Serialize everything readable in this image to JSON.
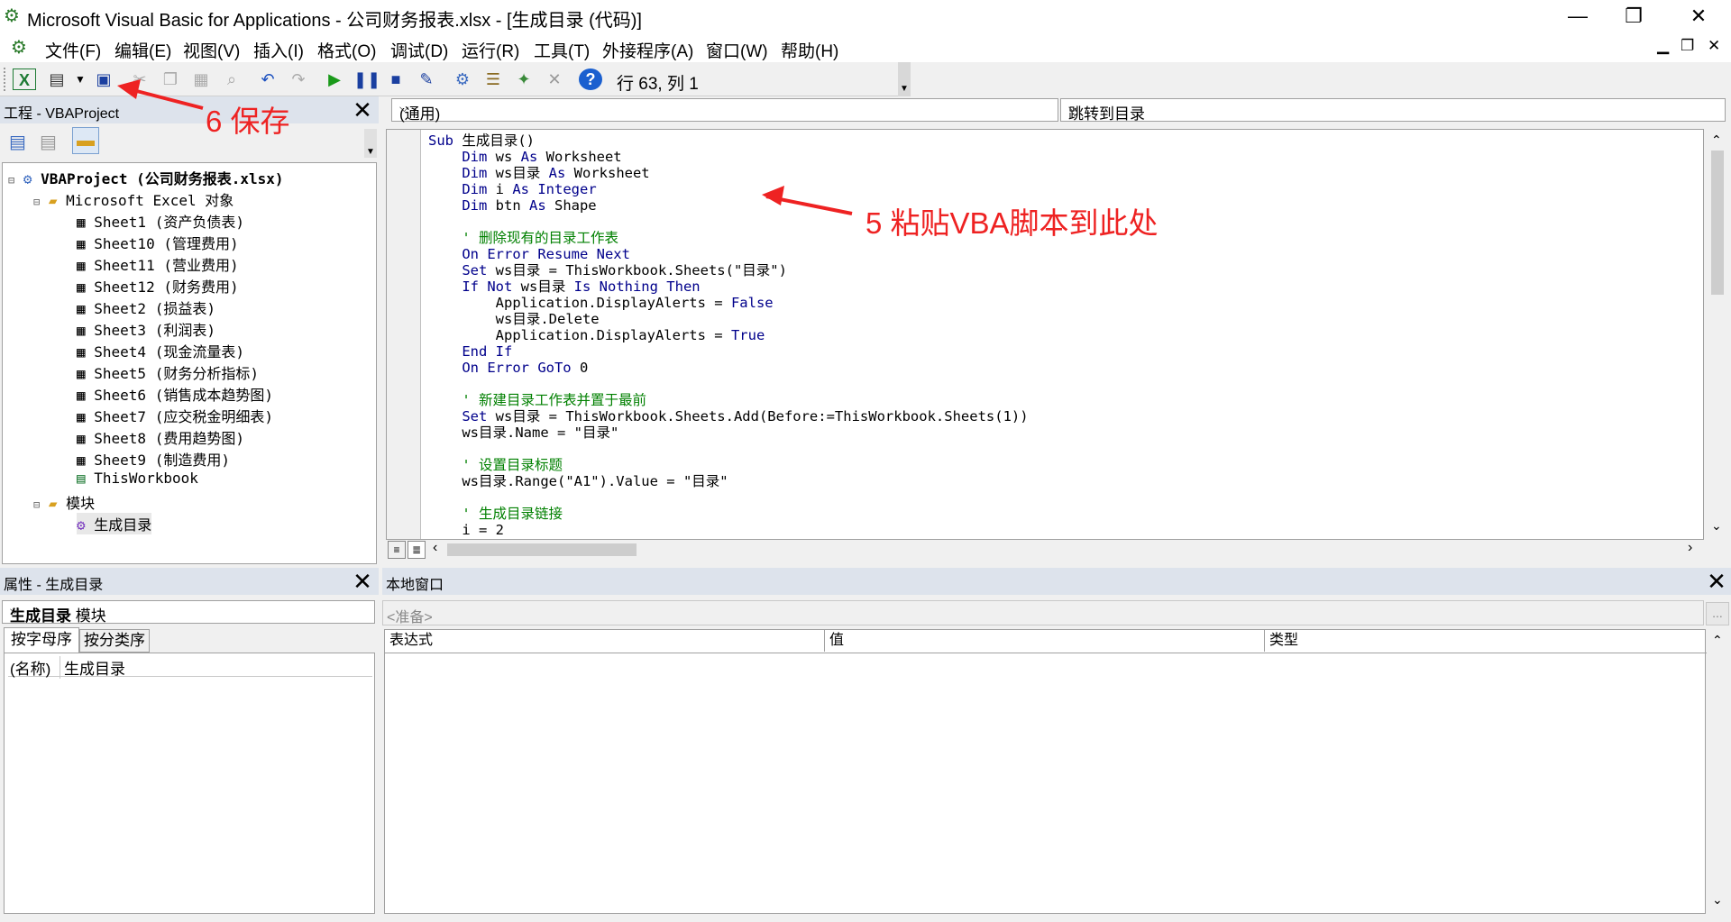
{
  "window": {
    "title": "Microsoft Visual Basic for Applications - 公司财务报表.xlsx - [生成目录 (代码)]",
    "minimize": "—",
    "restore": "❐",
    "close": "✕"
  },
  "menu": {
    "items": [
      "文件(F)",
      "编辑(E)",
      "视图(V)",
      "插入(I)",
      "格式(O)",
      "调试(D)",
      "运行(R)",
      "工具(T)",
      "外接程序(A)",
      "窗口(W)",
      "帮助(H)"
    ],
    "mdi_minimize": "▁",
    "mdi_restore": "❐",
    "mdi_close": "✕"
  },
  "toolbar": {
    "position": "行 63, 列 1",
    "icons": [
      "excel-icon",
      "insert-module-icon",
      "dropdown-icon",
      "save-icon",
      "cut-icon",
      "copy-icon",
      "paste-icon",
      "find-icon",
      "undo-icon",
      "redo-icon",
      "run-icon",
      "break-icon",
      "reset-icon",
      "design-mode-icon",
      "project-explorer-icon",
      "properties-icon",
      "object-browser-icon",
      "toolbox-icon",
      "help-icon"
    ]
  },
  "project_pane": {
    "title": "工程 - VBAProject",
    "root": "VBAProject (公司财务报表.xlsx)",
    "excel_objects_folder": "Microsoft Excel 对象",
    "sheets": [
      "Sheet1 (资产负债表)",
      "Sheet10 (管理费用)",
      "Sheet11 (营业费用)",
      "Sheet12 (财务费用)",
      "Sheet2 (损益表)",
      "Sheet3 (利润表)",
      "Sheet4 (现金流量表)",
      "Sheet5 (财务分析指标)",
      "Sheet6 (销售成本趋势图)",
      "Sheet7 (应交税金明细表)",
      "Sheet8 (费用趋势图)",
      "Sheet9 (制造费用)"
    ],
    "workbook": "ThisWorkbook",
    "modules_folder": "模块",
    "module": "生成目录"
  },
  "properties_pane": {
    "title": "属性 - 生成目录",
    "object_name": "生成目录",
    "object_type": "模块",
    "tab_alpha": "按字母序",
    "tab_category": "按分类序",
    "prop_name": "(名称)",
    "prop_value": "生成目录"
  },
  "code_window": {
    "object_combo": "(通用)",
    "proc_combo": "跳转到目录",
    "lines": [
      [
        [
          "kw",
          "Sub "
        ],
        [
          "txt",
          "生成目录()"
        ]
      ],
      [
        [
          "txt",
          "    "
        ],
        [
          "kw",
          "Dim "
        ],
        [
          "txt",
          "ws "
        ],
        [
          "kw",
          "As "
        ],
        [
          "txt",
          "Worksheet"
        ]
      ],
      [
        [
          "txt",
          "    "
        ],
        [
          "kw",
          "Dim "
        ],
        [
          "txt",
          "ws目录 "
        ],
        [
          "kw",
          "As "
        ],
        [
          "txt",
          "Worksheet"
        ]
      ],
      [
        [
          "txt",
          "    "
        ],
        [
          "kw",
          "Dim "
        ],
        [
          "txt",
          "i "
        ],
        [
          "kw",
          "As Integer"
        ]
      ],
      [
        [
          "txt",
          "    "
        ],
        [
          "kw",
          "Dim "
        ],
        [
          "txt",
          "btn "
        ],
        [
          "kw",
          "As "
        ],
        [
          "txt",
          "Shape"
        ]
      ],
      [
        [
          "txt",
          ""
        ]
      ],
      [
        [
          "txt",
          "    "
        ],
        [
          "cm",
          "' 删除现有的目录工作表"
        ]
      ],
      [
        [
          "txt",
          "    "
        ],
        [
          "kw",
          "On Error Resume Next"
        ]
      ],
      [
        [
          "txt",
          "    "
        ],
        [
          "kw",
          "Set "
        ],
        [
          "txt",
          "ws目录 = ThisWorkbook.Sheets(\"目录\")"
        ]
      ],
      [
        [
          "txt",
          "    "
        ],
        [
          "kw",
          "If Not "
        ],
        [
          "txt",
          "ws目录 "
        ],
        [
          "kw",
          "Is Nothing Then"
        ]
      ],
      [
        [
          "txt",
          "        Application.DisplayAlerts = "
        ],
        [
          "kw",
          "False"
        ]
      ],
      [
        [
          "txt",
          "        ws目录.Delete"
        ]
      ],
      [
        [
          "txt",
          "        Application.DisplayAlerts = "
        ],
        [
          "kw",
          "True"
        ]
      ],
      [
        [
          "txt",
          "    "
        ],
        [
          "kw",
          "End If"
        ]
      ],
      [
        [
          "txt",
          "    "
        ],
        [
          "kw",
          "On Error GoTo "
        ],
        [
          "txt",
          "0"
        ]
      ],
      [
        [
          "txt",
          ""
        ]
      ],
      [
        [
          "txt",
          "    "
        ],
        [
          "cm",
          "' 新建目录工作表并置于最前"
        ]
      ],
      [
        [
          "txt",
          "    "
        ],
        [
          "kw",
          "Set "
        ],
        [
          "txt",
          "ws目录 = ThisWorkbook.Sheets.Add(Before:=ThisWorkbook.Sheets(1))"
        ]
      ],
      [
        [
          "txt",
          "    ws目录.Name = \"目录\""
        ]
      ],
      [
        [
          "txt",
          ""
        ]
      ],
      [
        [
          "txt",
          "    "
        ],
        [
          "cm",
          "' 设置目录标题"
        ]
      ],
      [
        [
          "txt",
          "    ws目录.Range(\"A1\").Value = \"目录\""
        ]
      ],
      [
        [
          "txt",
          ""
        ]
      ],
      [
        [
          "txt",
          "    "
        ],
        [
          "cm",
          "' 生成目录链接"
        ]
      ],
      [
        [
          "txt",
          "    i = 2"
        ]
      ]
    ]
  },
  "locals_pane": {
    "title": "本地窗口",
    "status": "<准备>",
    "browse": "...",
    "col_expression": "表达式",
    "col_value": "值",
    "col_type": "类型"
  },
  "annotations": {
    "paste_note": "5 粘贴VBA脚本到此处",
    "save_note": "6 保存"
  },
  "colors": {
    "keyword": "#00008b",
    "comment": "#008000",
    "annotation": "#ee2222",
    "pane_header": "#dde3ec"
  }
}
